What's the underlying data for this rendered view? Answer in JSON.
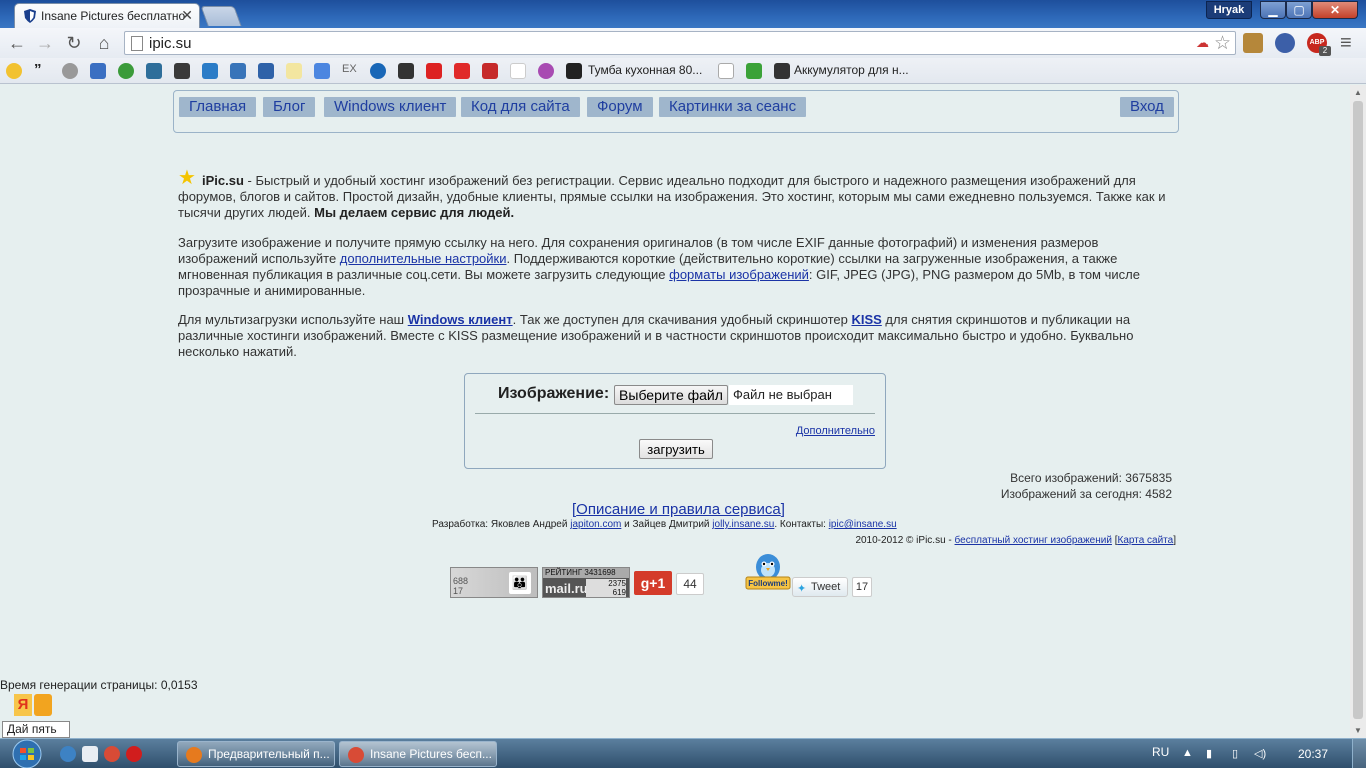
{
  "browser": {
    "tab_title": "Insane Pictures бесплатно",
    "tab_close": "✕",
    "user_name": "Hryak",
    "min_glyph": "▁",
    "max_glyph": "▢",
    "close_glyph": "✕",
    "url": "ipic.su",
    "back_glyph": "←",
    "forward_glyph": "→",
    "reload_glyph": "↻",
    "home_glyph": "⌂",
    "star_glyph": "☆",
    "cloud_glyph": "☁",
    "abp_label": "ABP",
    "abp_count": "2",
    "menu_glyph": "≡",
    "bookmarks": {
      "item1": "Тумба кухонная 80...",
      "item2": "Аккумулятор для н..."
    }
  },
  "site_nav": {
    "home": "Главная",
    "blog": "Блог",
    "windows_client": "Windows клиент",
    "site_code": "Код для сайта",
    "forum": "Форум",
    "session_pics": "Картинки за сеанс",
    "login": "Вход"
  },
  "intro": {
    "brand": "iPic.su",
    "p1_text": " - Быстрый и удобный хостинг изображений без регистрации. Сервис идеально подходит для быстрого и надежного размещения изображений для форумов, блогов и сайтов. Простой дизайн, удобные клиенты, прямые ссылки на изображения. Это хостинг, которым мы сами ежедневно пользуемся. Также как и тысячи других людей. ",
    "p1_bold": "Мы делаем сервис для людей.",
    "p2_a": "Загрузите изображение и получите прямую ссылку на него. Для сохранения оригиналов (в том числе EXIF данные фотографий) и изменения размеров изображений используйте ",
    "p2_link1": "дополнительные настройки",
    "p2_b": ". Поддерживаются короткие (действительно короткие) ссылки на загруженные изображения, а также мгновенная публикация в различные соц.сети. Вы можете загрузить следующие ",
    "p2_link2": "форматы изображений",
    "p2_c": ": GIF, JPEG (JPG), PNG размером до 5Mb, в том числе прозрачные и анимированные.",
    "p3_a": "Для мультизагрузки используйте наш ",
    "p3_link1": "Windows клиент",
    "p3_b": ". Так же доступен для скачивания удобный скриншотер ",
    "p3_link2": "KISS",
    "p3_c": " для снятия скриншотов и публикации на различные хостинги изображений. Вместе с KISS размещение изображений и в частности скриншотов происходит максимально быстро и удобно. Буквально несколько нажатий."
  },
  "upload": {
    "label": "Изображение:",
    "choose_file": "Выберите файл",
    "file_status": "Файл не выбран",
    "advanced": "Дополнительно",
    "submit": "загрузить"
  },
  "stats": {
    "total": "Всего изображений: 3675835",
    "today": "Изображений за сегодня: 4582"
  },
  "footer": {
    "rules_open": "[",
    "rules": "Описание и правила сервиса",
    "rules_close": "]",
    "credits_a": "Разработка: Яковлев Андрей ",
    "credits_link1": "japiton.com",
    "credits_b": " и Зайцев Дмитрий ",
    "credits_link2": "jolly.insane.su",
    "credits_c": ". Контакты: ",
    "credits_link3": "ipic@insane.su",
    "copy_a": "2010-2012 © iPic.su - ",
    "copy_link1": "бесплатный хостинг изображений",
    "copy_b": " [",
    "copy_link2": "Карта сайта",
    "copy_c": "]"
  },
  "widgets": {
    "li_n1": "688",
    "li_n2": "17",
    "mail_top": "РЕЙТИНГ  3431698",
    "mail_brand": "mail.ru",
    "mail_n1": "2375",
    "mail_n2": "619",
    "gplus": "g+1",
    "gplus_count": "44",
    "followme": "Followme!",
    "tweet": "Tweet",
    "tweet_count": "17"
  },
  "page": {
    "gen_time": "Время генерации страницы: 0,0153",
    "yandex_tooltip": "Дай пять"
  },
  "taskbar": {
    "task1": "Предварительный п...",
    "task2": "Insane Pictures бесп...",
    "lang": "RU",
    "clock": "20:37"
  }
}
